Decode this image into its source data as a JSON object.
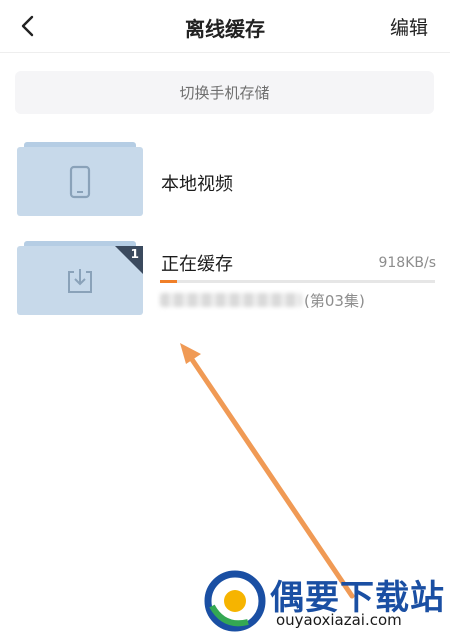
{
  "header": {
    "back_icon": "chevron-left-icon",
    "title": "离线缓存",
    "edit_label": "编辑"
  },
  "storage_switch": {
    "label": "切换手机存储"
  },
  "folders": [
    {
      "label": "本地视频",
      "icon": "phone-icon"
    },
    {
      "label": "正在缓存",
      "icon": "download-icon",
      "badge_count": "1",
      "speed": "918KB/s",
      "progress_fraction": 0.06,
      "episode_text": "(第03集)"
    }
  ],
  "colors": {
    "folder_fill": "#c7d9ea",
    "folder_tab": "#b5cde4",
    "badge": "#3b4a5e",
    "progress": "#f07f28",
    "annotation_arrow": "#f09a55",
    "watermark_blue": "#1a4fa3"
  },
  "watermark": {
    "name": "偶要下载站",
    "url": "ouyaoxiazai.com"
  }
}
